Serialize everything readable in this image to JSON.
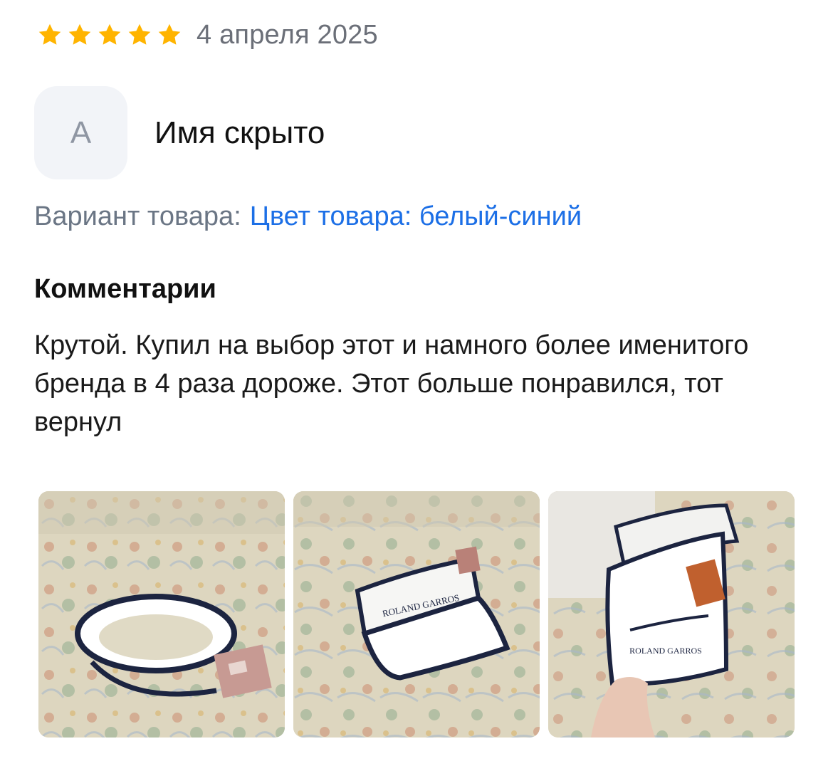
{
  "review": {
    "rating": 5,
    "rating_max": 5,
    "star_color": "#ffb400",
    "star_icon": "star-icon",
    "date": "4 апреля 2025",
    "author": {
      "avatar_letter": "А",
      "name": "Имя скрыто"
    },
    "variant": {
      "label": "Вариант товара:",
      "value": "Цвет товара: белый-синий"
    },
    "comments_title": "Комментарии",
    "comment": "Крутой. Купил на выбор этот и намного более именитого бренда в 4 раза дороже. Этот больше понравился, тот вернул",
    "photos": [
      {
        "name": "review-photo-1"
      },
      {
        "name": "review-photo-2"
      },
      {
        "name": "review-photo-3"
      }
    ]
  },
  "colors": {
    "link": "#1c6fe6",
    "muted": "#6b7685",
    "avatar_bg": "#f2f4f8"
  }
}
